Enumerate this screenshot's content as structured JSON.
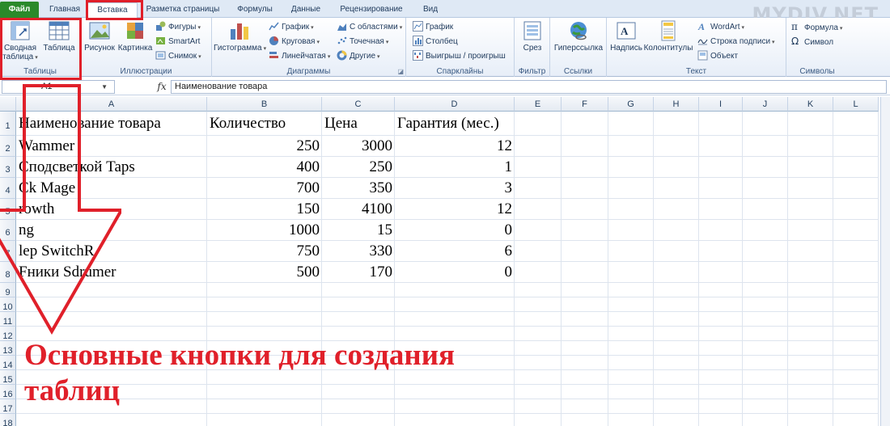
{
  "tabs": [
    {
      "label": "Файл"
    },
    {
      "label": "Главная"
    },
    {
      "label": "Вставка"
    },
    {
      "label": "Разметка страницы"
    },
    {
      "label": "Формулы"
    },
    {
      "label": "Данные"
    },
    {
      "label": "Рецензирование"
    },
    {
      "label": "Вид"
    }
  ],
  "watermark": "MYDIV.NET",
  "ribbon": {
    "tables": {
      "label": "Таблицы",
      "pivot_line1": "Сводная",
      "pivot_line2": "таблица",
      "table": "Таблица"
    },
    "illustrations": {
      "label": "Иллюстрации",
      "picture": "Рисунок",
      "clipart": "Картинка",
      "shapes": "Фигуры",
      "smartart": "SmartArt",
      "screenshot": "Снимок"
    },
    "charts": {
      "label": "Диаграммы",
      "histogram": "Гистограмма",
      "line": "График",
      "pie": "Круговая",
      "bar": "Линейчатая",
      "area": "С областями",
      "scatter": "Точечная",
      "other": "Другие"
    },
    "sparklines": {
      "label": "Спарклайны",
      "line": "График",
      "column": "Столбец",
      "winloss": "Выигрыш / проигрыш"
    },
    "filter": {
      "label": "Фильтр",
      "slicer": "Срез"
    },
    "links": {
      "label": "Ссылки",
      "hyperlink": "Гиперссылка"
    },
    "text": {
      "label": "Текст",
      "textbox": "Надпись",
      "header": "Колонтитулы",
      "wordart": "WordArt",
      "signature": "Строка подписи",
      "object": "Объект"
    },
    "symbols": {
      "label": "Символы",
      "formula": "Формула",
      "symbol": "Символ"
    }
  },
  "formula_bar": {
    "cell_ref": "A1",
    "fx": "fx",
    "content": "Наименование товара"
  },
  "columns": [
    "A",
    "B",
    "C",
    "D",
    "E",
    "F",
    "G",
    "H",
    "I",
    "J",
    "K",
    "L"
  ],
  "rows": [
    "1",
    "2",
    "3",
    "4",
    "5",
    "6",
    "7",
    "8",
    "9",
    "10",
    "11",
    "12",
    "13",
    "14",
    "15",
    "16",
    "17",
    "18"
  ],
  "table": {
    "headers": [
      "Наименование товара",
      "Количество",
      "Цена",
      "Гарантия (мес.)"
    ],
    "rows": [
      {
        "name": "Wammer",
        "qty": "250",
        "price": "3000",
        "warranty": "12"
      },
      {
        "name": "Сподсветкой Taps",
        "qty": "400",
        "price": "250",
        "warranty": "1"
      },
      {
        "name": "Сk Mage",
        "qty": "700",
        "price": "350",
        "warranty": "3"
      },
      {
        "name": "rowth",
        "qty": "150",
        "price": "4100",
        "warranty": "12"
      },
      {
        "name": "ng",
        "qty": "1000",
        "price": "15",
        "warranty": "0"
      },
      {
        "name": "lep SwitchR",
        "qty": "750",
        "price": "330",
        "warranty": "6"
      },
      {
        "name": "Fники Sdrumer",
        "qty": "500",
        "price": "170",
        "warranty": "0"
      }
    ]
  },
  "annotation": {
    "line1": "Основные кнопки для создания",
    "line2": "таблиц"
  },
  "colors": {
    "accent_red": "#e0202a",
    "file_tab": "#2a8a2a"
  }
}
